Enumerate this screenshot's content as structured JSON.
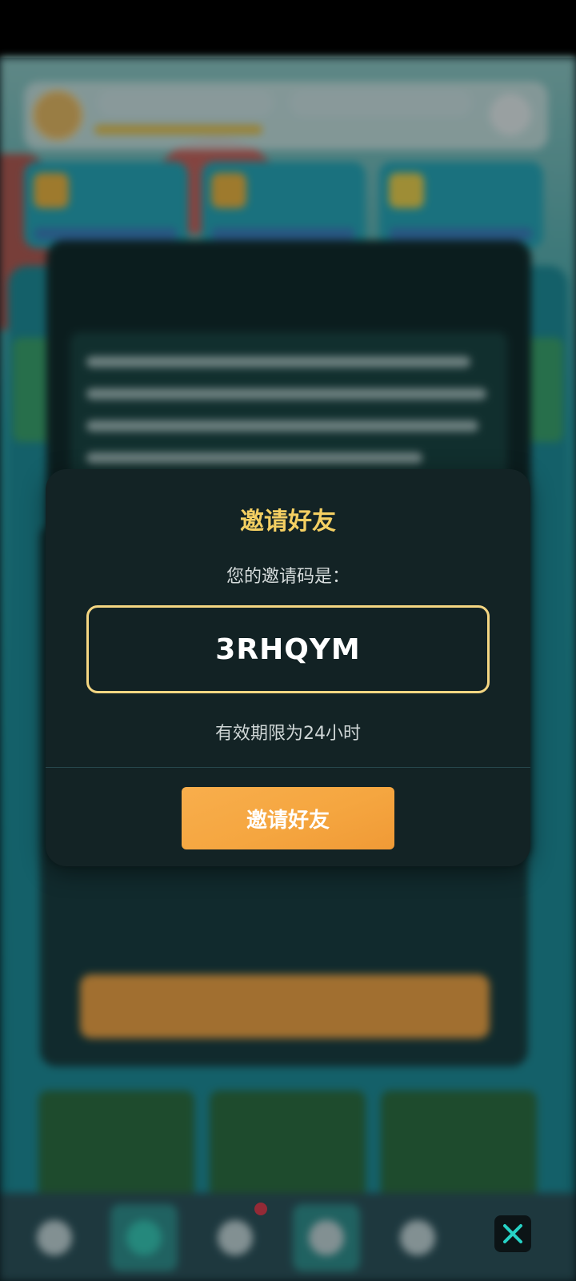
{
  "modal": {
    "title": "邀请好友",
    "subtitle": "您的邀请码是：",
    "code": "3RHQYM",
    "expiry": "有效期限为24小时",
    "button_label": "邀请好友"
  },
  "colors": {
    "title": "#f4cf62",
    "code_border": "#f4d682",
    "button": "#f5a640",
    "modal_bg": "#132325",
    "close_icon": "#27d3c6"
  },
  "icons": {
    "close": "close-icon",
    "nav": [
      "warning-icon",
      "badge-icon",
      "gear-icon",
      "diamond-icon",
      "heart-icon"
    ]
  }
}
